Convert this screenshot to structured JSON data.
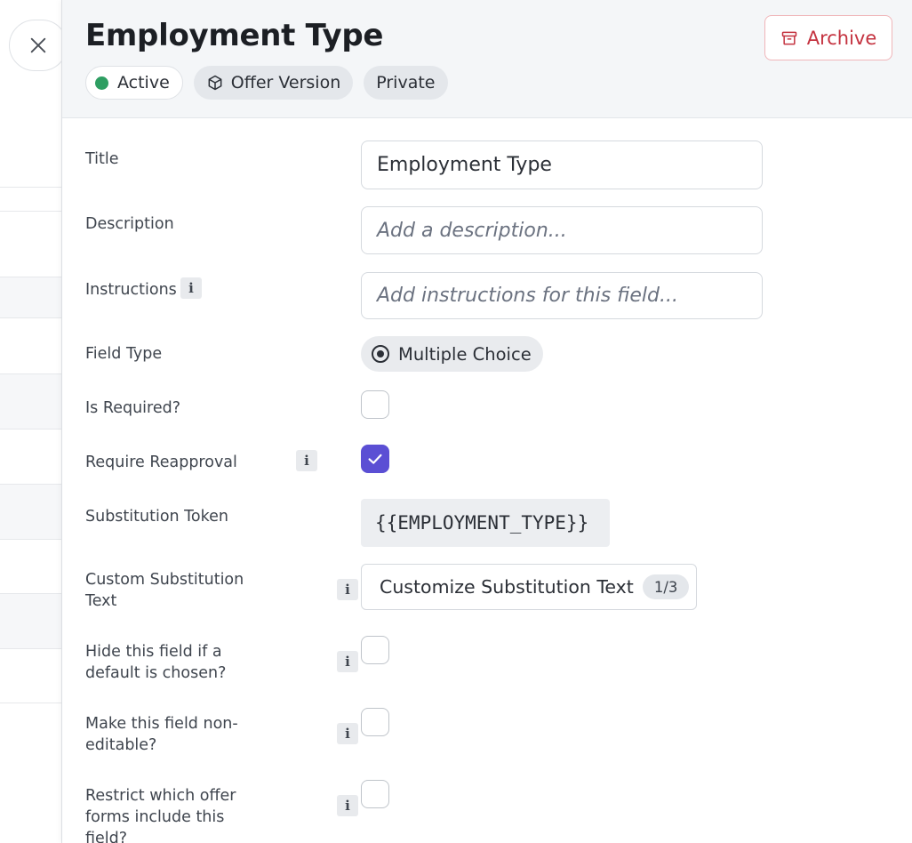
{
  "header": {
    "title": "Employment Type",
    "badges": {
      "active": "Active",
      "offer_version": "Offer Version",
      "private": "Private"
    },
    "archive_label": "Archive"
  },
  "form": {
    "title": {
      "label": "Title",
      "value": "Employment Type"
    },
    "description": {
      "label": "Description",
      "placeholder": "Add a description..."
    },
    "instructions": {
      "label": "Instructions",
      "placeholder": "Add instructions for this field..."
    },
    "field_type": {
      "label": "Field Type",
      "value": "Multiple Choice"
    },
    "is_required": {
      "label": "Is Required?",
      "checked": false
    },
    "require_reapproval": {
      "label": "Require Reapproval",
      "checked": true
    },
    "substitution_token": {
      "label": "Substitution Token",
      "value": "{{EMPLOYMENT_TYPE}}"
    },
    "custom_substitution": {
      "label": "Custom Substitution Text",
      "button_label": "Customize Substitution Text",
      "count": "1/3"
    },
    "hide_if_default": {
      "label": "Hide this field if a default is chosen?",
      "checked": false
    },
    "non_editable": {
      "label": "Make this field non-editable?",
      "checked": false
    },
    "restrict_forms": {
      "label": "Restrict which offer forms include this field?",
      "checked": false
    }
  },
  "icons": {
    "close": "close-icon",
    "info": "i",
    "archive": "archive-icon",
    "cube": "cube-icon",
    "radio": "radio-icon",
    "check": "check-icon"
  },
  "colors": {
    "active_dot": "#2e9e62",
    "archive_red": "#c4323f",
    "checkbox_checked": "#5b4fd4"
  }
}
